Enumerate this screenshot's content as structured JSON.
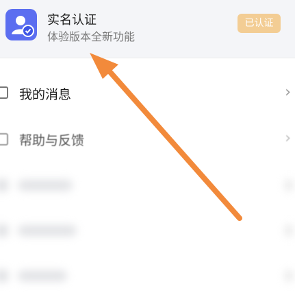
{
  "verification": {
    "title": "实名认证",
    "subtitle": "体验版本全新功能",
    "badge": "已认证"
  },
  "menu": {
    "items": [
      {
        "label": "我的消息",
        "icon": "message-icon"
      },
      {
        "label": "帮助与反馈",
        "icon": "help-icon"
      }
    ]
  },
  "colors": {
    "accent_icon": "#5b6ef0",
    "badge_bg": "#f3cd94",
    "arrow": "#f28a3b"
  }
}
